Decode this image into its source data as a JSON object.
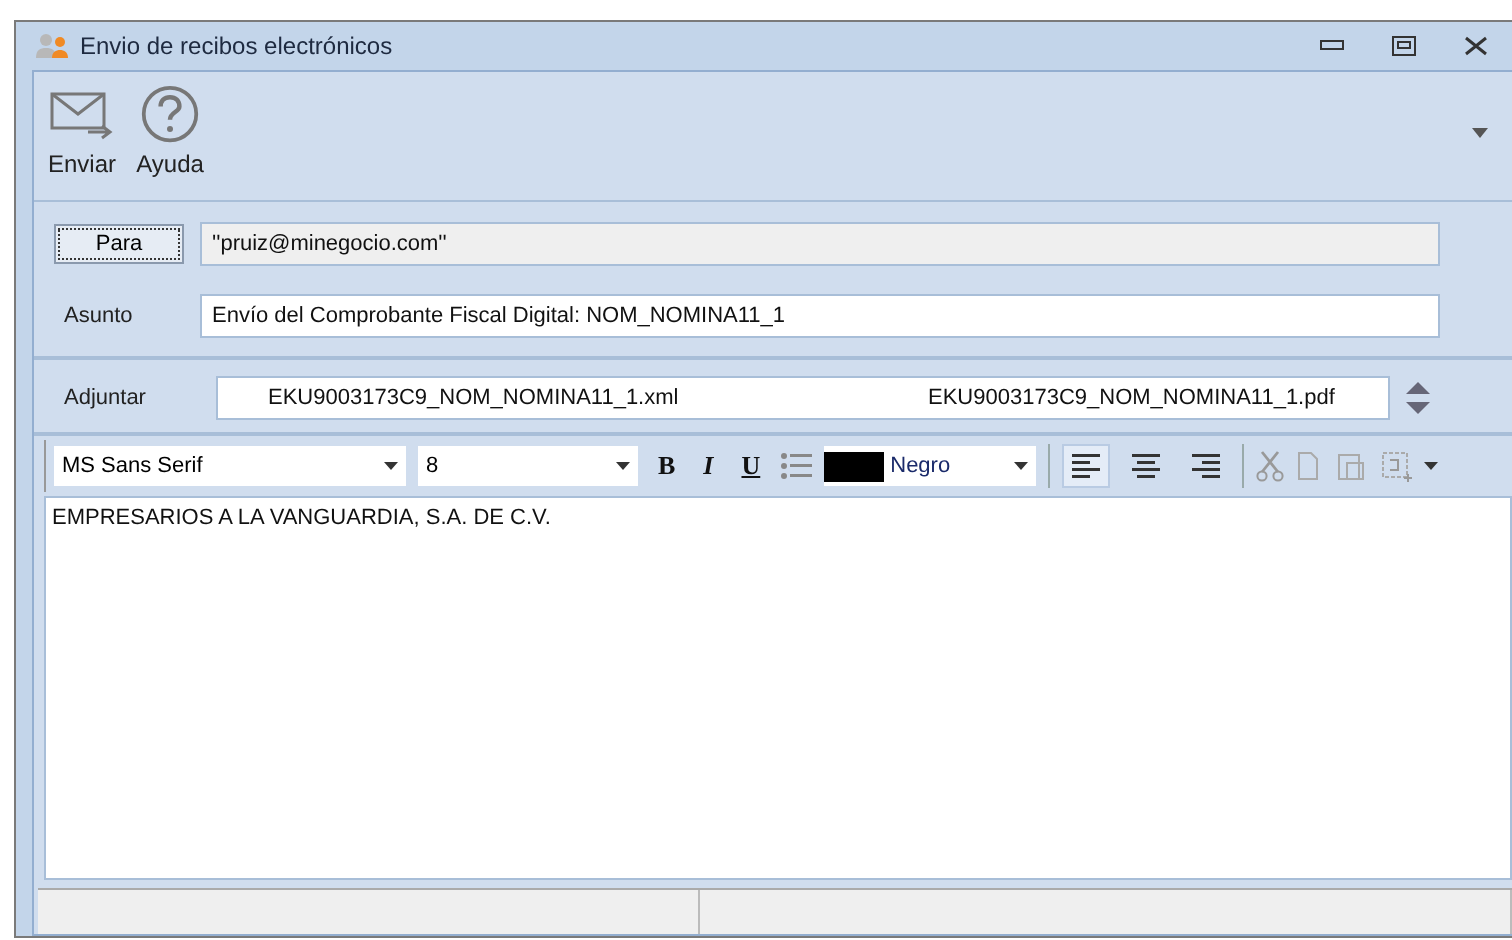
{
  "window": {
    "title": "Envio de recibos electrónicos"
  },
  "toolbar": {
    "buttons": [
      {
        "kind": "send",
        "label": "Enviar"
      },
      {
        "kind": "help",
        "label": "Ayuda"
      }
    ]
  },
  "form": {
    "to": {
      "button": "Para",
      "value": "''pruiz@minegocio.com''"
    },
    "subject": {
      "label": "Asunto",
      "value": "Envío del Comprobante Fiscal Digital: NOM_NOMINA11_1"
    },
    "attach": {
      "label": "Adjuntar",
      "files": [
        "EKU9003173C9_NOM_NOMINA11_1.xml",
        "EKU9003173C9_NOM_NOMINA11_1.pdf"
      ]
    }
  },
  "format_bar": {
    "font": "MS Sans Serif",
    "size": "8",
    "styles": [
      {
        "kind": "bold",
        "label": "B"
      },
      {
        "kind": "italic",
        "label": "I"
      },
      {
        "kind": "underline",
        "label": "U"
      }
    ],
    "color": {
      "name": "Negro",
      "color": "#000000"
    },
    "align": [
      {
        "kind": "left",
        "selected": true
      },
      {
        "kind": "center",
        "selected": false
      },
      {
        "kind": "right",
        "selected": false
      }
    ]
  },
  "body": {
    "text": "EMPRESARIOS A LA VANGUARDIA, S.A. DE C.V."
  }
}
